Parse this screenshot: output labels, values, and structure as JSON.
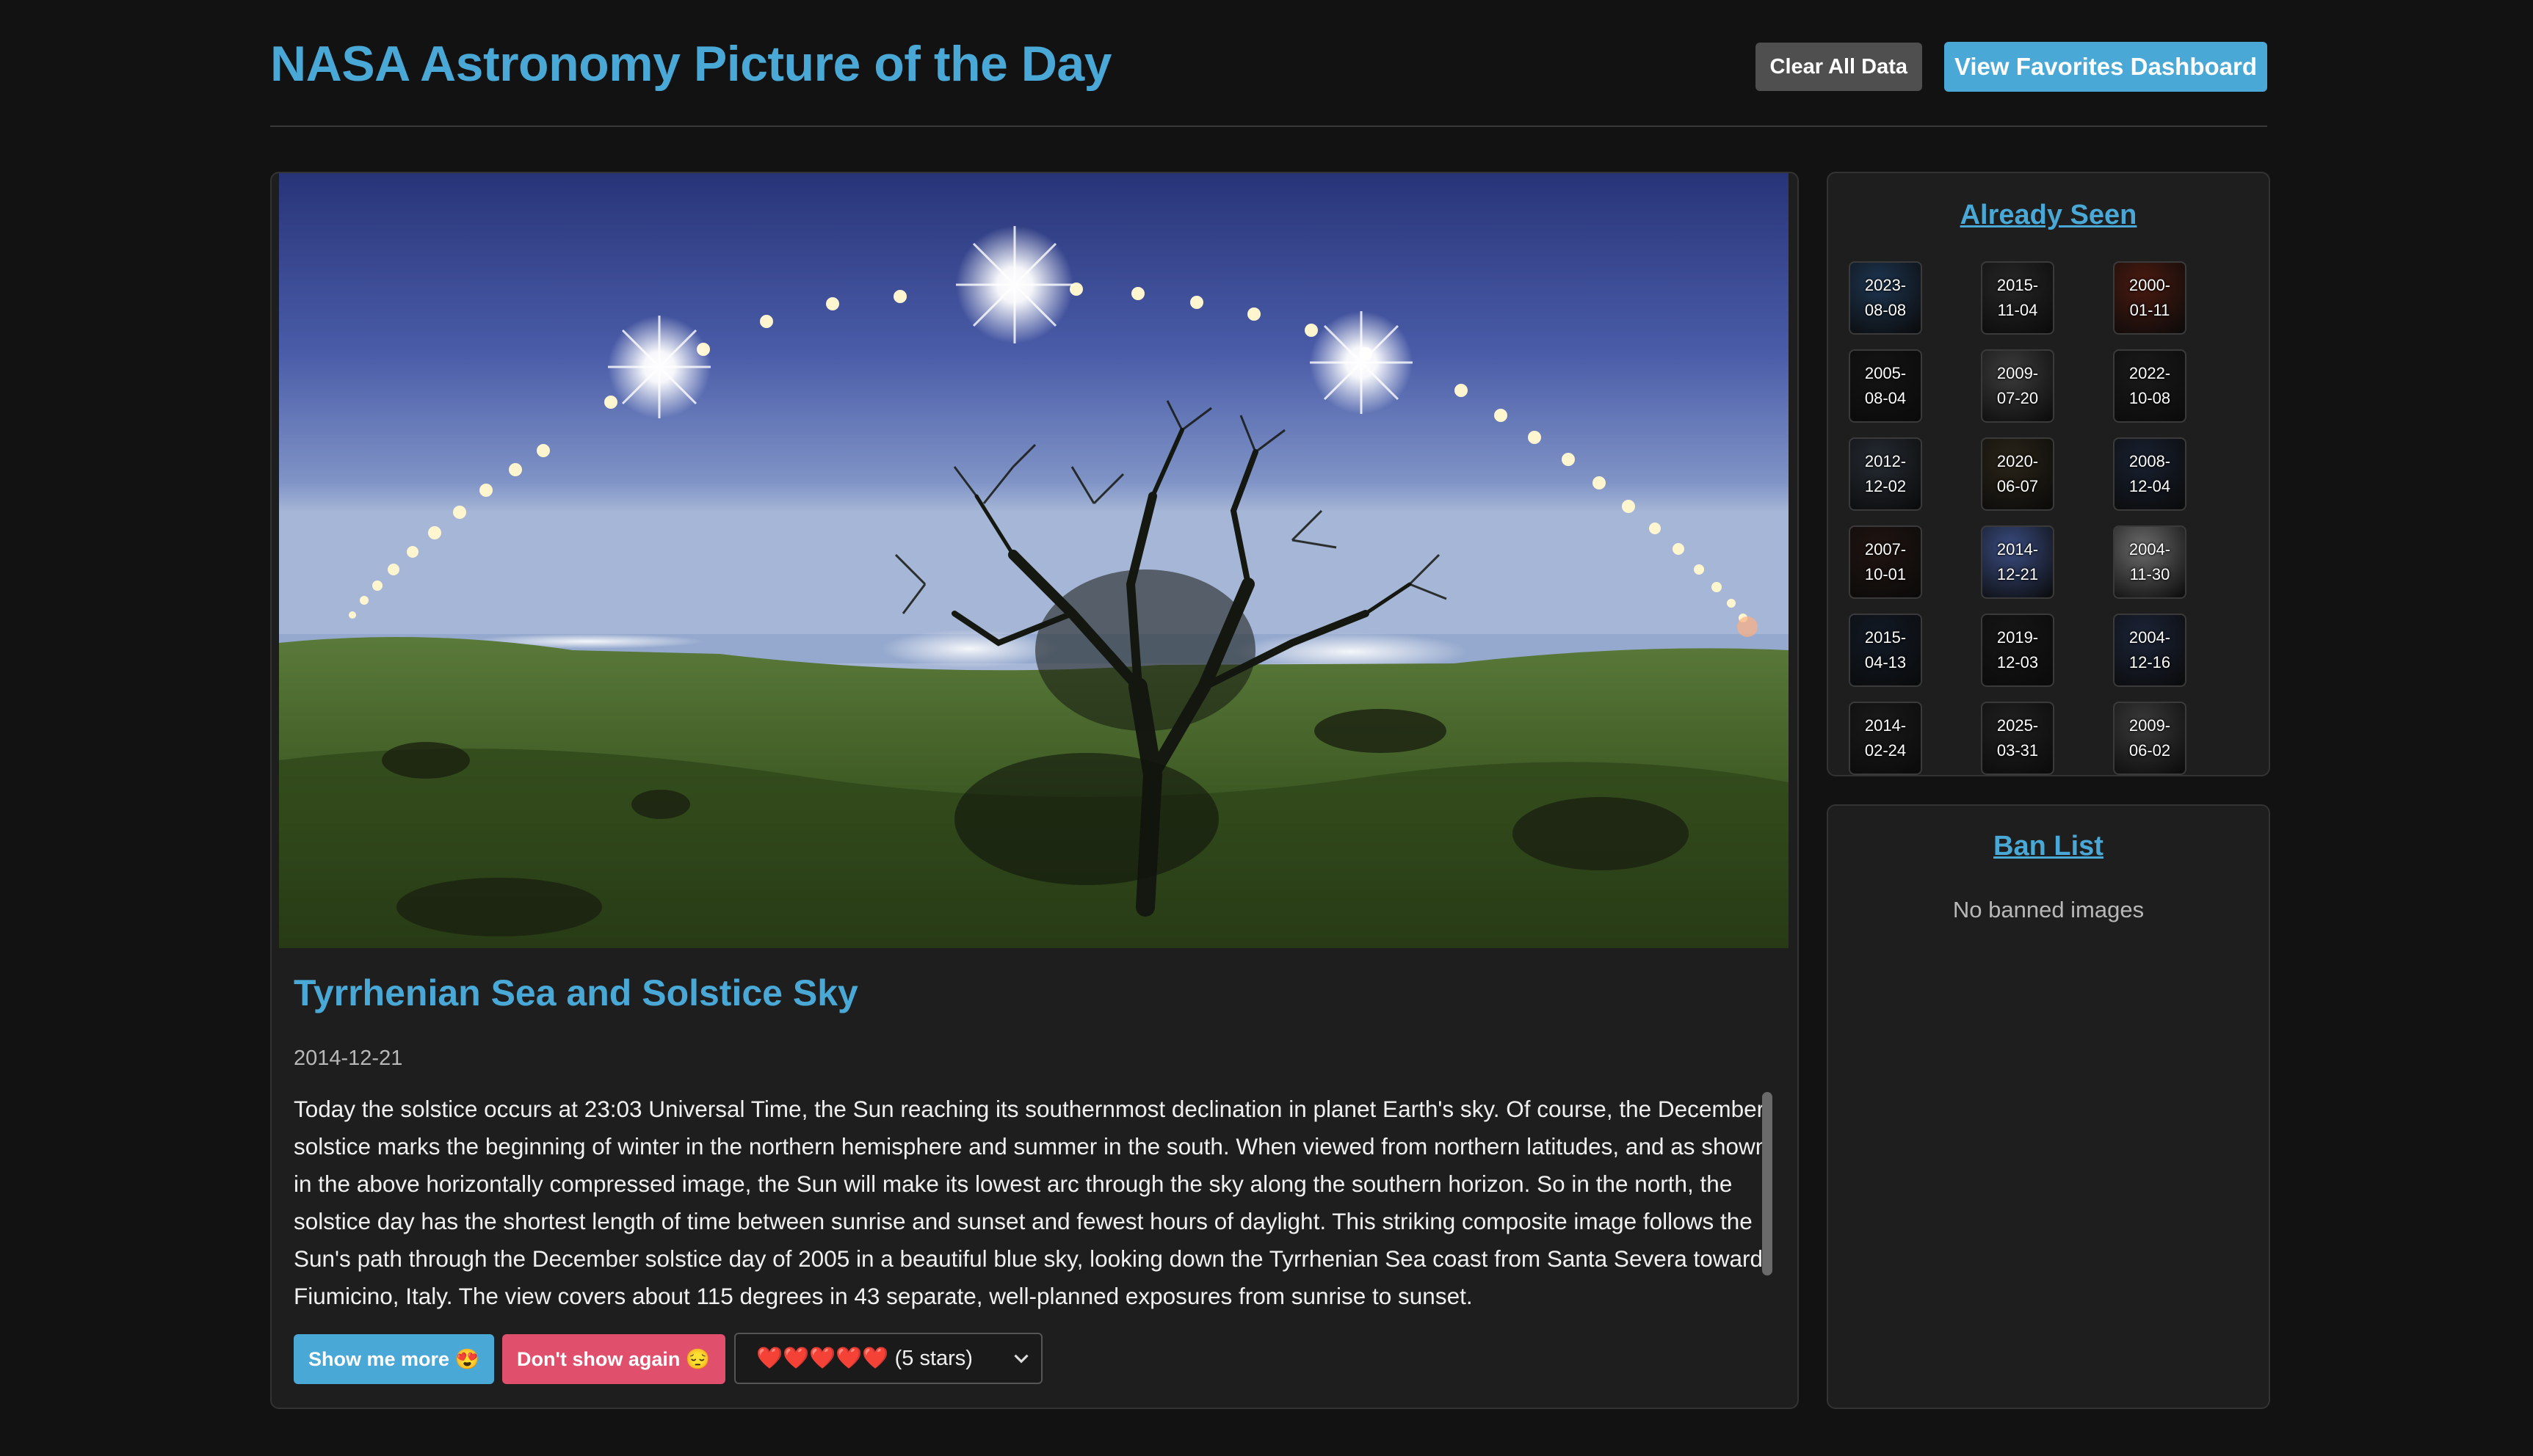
{
  "header": {
    "title": "NASA Astronomy Picture of the Day",
    "clear_label": "Clear All Data",
    "favorites_label": "View Favorites Dashboard"
  },
  "apod": {
    "title": "Tyrrhenian Sea and Solstice Sky",
    "date": "2014-12-21",
    "explanation": "Today the solstice occurs at 23:03 Universal Time, the Sun reaching its southernmost declination in planet Earth's sky. Of course, the December solstice marks the beginning of winter in the northern hemisphere and summer in the south. When viewed from northern latitudes, and as shown in the above horizontally compressed image, the Sun will make its lowest arc through the sky along the southern horizon. So in the north, the solstice day has the shortest length of time between sunrise and sunset and fewest hours of daylight. This striking composite image follows the Sun's path through the December solstice day of 2005 in a beautiful blue sky, looking down the Tyrrhenian Sea coast from Santa Severa toward Fiumicino, Italy. The view covers about 115 degrees in 43 separate, well-planned exposures from sunrise to sunset."
  },
  "actions": {
    "more_label": "Show me more 😍",
    "ban_label": "Don't show again 😔",
    "rating_value": "❤️❤️❤️❤️❤️ (5 stars)"
  },
  "seen": {
    "title": "Already Seen",
    "items": [
      {
        "line1": "2023-",
        "line2": "08-08",
        "color": "#1d3550"
      },
      {
        "line1": "2015-",
        "line2": "11-04",
        "color": "#262626"
      },
      {
        "line1": "2000-",
        "line2": "01-11",
        "color": "#4a1a10"
      },
      {
        "line1": "2005-",
        "line2": "08-04",
        "color": "#141414"
      },
      {
        "line1": "2009-",
        "line2": "07-20",
        "color": "#3c3c3c"
      },
      {
        "line1": "2022-",
        "line2": "10-08",
        "color": "#1a1a1a"
      },
      {
        "line1": "2012-",
        "line2": "12-02",
        "color": "#252b33"
      },
      {
        "line1": "2020-",
        "line2": "06-07",
        "color": "#2a2418"
      },
      {
        "line1": "2008-",
        "line2": "12-04",
        "color": "#182030"
      },
      {
        "line1": "2007-",
        "line2": "10-01",
        "color": "#201410"
      },
      {
        "line1": "2014-",
        "line2": "12-21",
        "color": "#3a4c80"
      },
      {
        "line1": "2004-",
        "line2": "11-30",
        "color": "#6a6a6a"
      },
      {
        "line1": "2015-",
        "line2": "04-13",
        "color": "#121a26"
      },
      {
        "line1": "2019-",
        "line2": "12-03",
        "color": "#161616"
      },
      {
        "line1": "2004-",
        "line2": "12-16",
        "color": "#1c2438"
      },
      {
        "line1": "2014-",
        "line2": "02-24",
        "color": "#1a1a1a"
      },
      {
        "line1": "2025-",
        "line2": "03-31",
        "color": "#202020"
      },
      {
        "line1": "2009-",
        "line2": "06-02",
        "color": "#3a3a3a"
      }
    ]
  },
  "ban": {
    "title": "Ban List",
    "empty": "No banned images"
  }
}
